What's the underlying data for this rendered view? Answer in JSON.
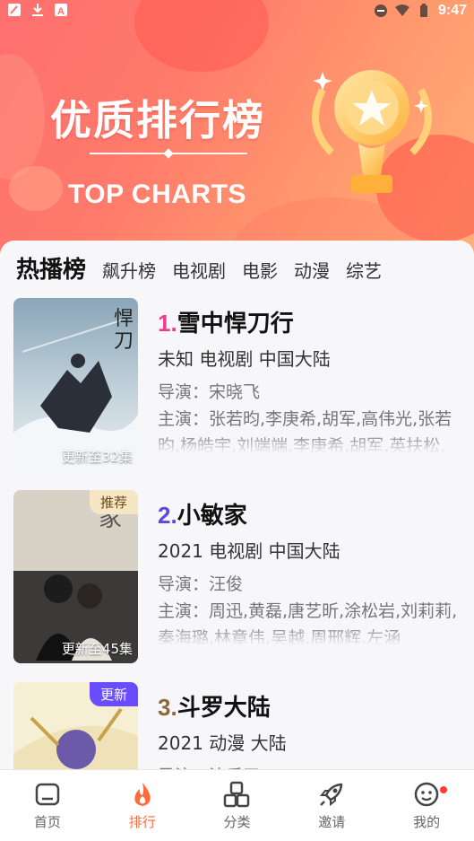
{
  "status": {
    "time": "9:47"
  },
  "hero": {
    "title": "优质排行榜",
    "subtitle": "TOP CHARTS"
  },
  "tabs": [
    {
      "label": "热播榜",
      "active": true
    },
    {
      "label": "飙升榜",
      "active": false
    },
    {
      "label": "电视剧",
      "active": false
    },
    {
      "label": "电影",
      "active": false
    },
    {
      "label": "动漫",
      "active": false
    },
    {
      "label": "综艺",
      "active": false
    }
  ],
  "list": [
    {
      "rank": "1.",
      "rank_color": "#e83e8c",
      "title": "雪中悍刀行",
      "meta": "未知  电视剧  中国大陆",
      "director": "导演：宋晓飞",
      "cast": "主演：张若昀,李庚希,胡军,高伟光,张若昀,杨皓宇,刘端端,李庚希,胡军,英扶松,王道,张天爱,丞",
      "update": "更新至32集",
      "badge": ""
    },
    {
      "rank": "2.",
      "rank_color": "#5a4ae3",
      "title": "小敏家",
      "meta": "2021  电视剧  中国大陆",
      "director": "导演：汪俊",
      "cast": "主演：周迅,黄磊,唐艺昕,涂松岩,刘莉莉,秦海璐,林章伟,吴越,周邢辉,左涵",
      "update": "更新至45集",
      "badge": "推荐"
    },
    {
      "rank": "3.",
      "rank_color": "#8b6a3a",
      "title": "斗罗大陆",
      "meta": "2021  动漫  大陆",
      "director": "导演：沈乐平",
      "cast": "",
      "update": "",
      "badge": "更新"
    }
  ],
  "nav": [
    {
      "label": "首页",
      "icon": "home-icon",
      "active": false
    },
    {
      "label": "排行",
      "icon": "fire-icon",
      "active": true
    },
    {
      "label": "分类",
      "icon": "category-icon",
      "active": false
    },
    {
      "label": "邀请",
      "icon": "rocket-icon",
      "active": false
    },
    {
      "label": "我的",
      "icon": "profile-icon",
      "active": false
    }
  ],
  "colors": {
    "accent": "#ff6a3d"
  }
}
